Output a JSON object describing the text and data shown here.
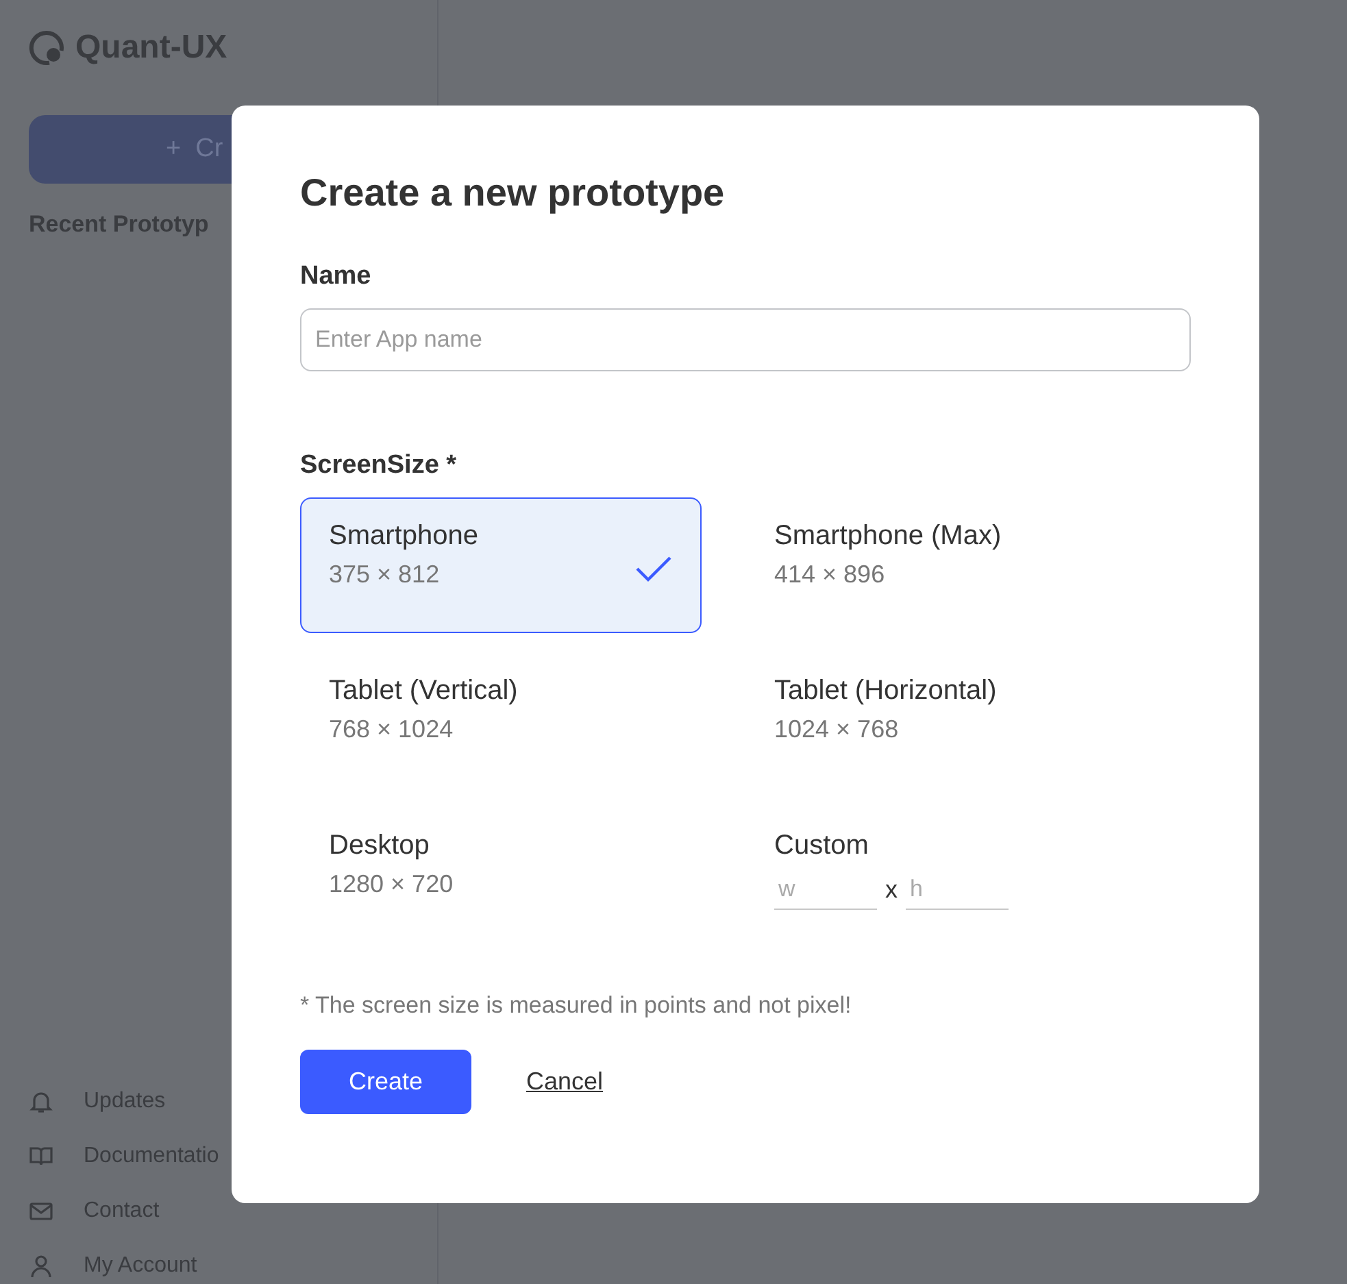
{
  "app": {
    "logo": "Quant-UX"
  },
  "sidebar": {
    "create_button": "+  Cr",
    "recent_heading": "Recent Prototyp",
    "links": [
      {
        "kind": "bell",
        "label": "Updates"
      },
      {
        "kind": "book",
        "label": "Documentatio"
      },
      {
        "kind": "mail",
        "label": "Contact"
      },
      {
        "kind": "user",
        "label": "My Account"
      }
    ]
  },
  "dialog": {
    "title": "Create a new prototype",
    "name_field": {
      "label": "Name",
      "placeholder": "Enter App name"
    },
    "screen_size": {
      "label": "ScreenSize *",
      "options": [
        {
          "kind": "preset",
          "name": "Smartphone",
          "dims": "375 × 812",
          "selected": true
        },
        {
          "kind": "preset",
          "name": "Smartphone (Max)",
          "dims": "414 × 896",
          "selected": false
        },
        {
          "kind": "preset",
          "name": "Tablet (Vertical)",
          "dims": "768 × 1024",
          "selected": false
        },
        {
          "kind": "preset",
          "name": "Tablet (Horizontal)",
          "dims": "1024 × 768",
          "selected": false
        },
        {
          "kind": "preset",
          "name": "Desktop",
          "dims": "1280 × 720",
          "selected": false
        },
        {
          "kind": "custom",
          "name": "Custom",
          "w_placeholder": "w",
          "separator": "x",
          "h_placeholder": "h",
          "selected": false
        }
      ]
    },
    "note": "* The screen size is measured in points and not pixel!",
    "create_button": "Create",
    "cancel_link": "Cancel"
  }
}
